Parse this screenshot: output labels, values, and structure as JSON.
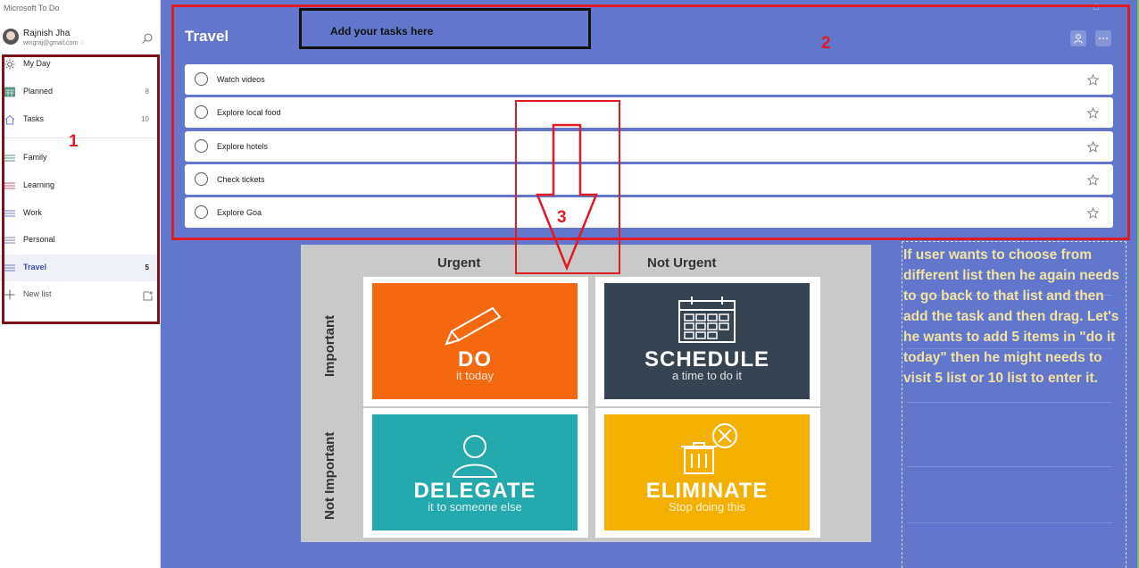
{
  "app": {
    "title": "Microsoft To Do"
  },
  "user": {
    "name": "Rajnish Jha",
    "email": "wingraj@gmail.com ♢"
  },
  "sidebar": {
    "items": [
      {
        "label": "My Day",
        "count": ""
      },
      {
        "label": "Planned",
        "count": "8"
      },
      {
        "label": "Tasks",
        "count": "10"
      },
      {
        "label": "Family",
        "count": ""
      },
      {
        "label": "Learning",
        "count": ""
      },
      {
        "label": "Work",
        "count": ""
      },
      {
        "label": "Personal",
        "count": ""
      },
      {
        "label": "Travel",
        "count": "5"
      }
    ],
    "new_list_label": "New list"
  },
  "main": {
    "list_title": "Travel",
    "add_tasks_label": "Add your tasks here",
    "tasks": [
      {
        "title": "Watch videos"
      },
      {
        "title": "Explore local food"
      },
      {
        "title": "Explore hotels"
      },
      {
        "title": "Check tickets"
      },
      {
        "title": "Explore Goa"
      }
    ]
  },
  "annotations": {
    "one": "1",
    "two": "2",
    "three": "3"
  },
  "matrix": {
    "col_urgent": "Urgent",
    "col_not_urgent": "Not Urgent",
    "row_important": "Important",
    "row_not_important": "Not Important",
    "do_title": "DO",
    "do_sub": "it today",
    "schedule_title": "SCHEDULE",
    "schedule_sub": "a time to do it",
    "delegate_title": "DELEGATE",
    "delegate_sub": "it to someone else",
    "eliminate_title": "ELIMINATE",
    "eliminate_sub": "Stop doing this"
  },
  "note": "If user wants to choose from different list then he again needs to go back to that list and then add the task and then drag. Let's he wants to add 5 items in \"do it today\" then he might needs to  visit 5 list or 10 list to enter it.",
  "colors": {
    "main_bg": "#6277cc",
    "accent": "#3c4fb3",
    "annotation_red": "#e01b24",
    "annotation_dark_red": "#7b1419",
    "do": "#f4690f",
    "schedule": "#364350",
    "delegate": "#23a9ae",
    "eliminate": "#f4b000",
    "note_text": "#f2e2a2"
  },
  "icons": {
    "my_day": "sun-icon",
    "planned": "calendar-icon",
    "tasks": "home-icon",
    "lists": "list-lines-icon",
    "new_list": "plus-icon",
    "search": "search-icon"
  }
}
